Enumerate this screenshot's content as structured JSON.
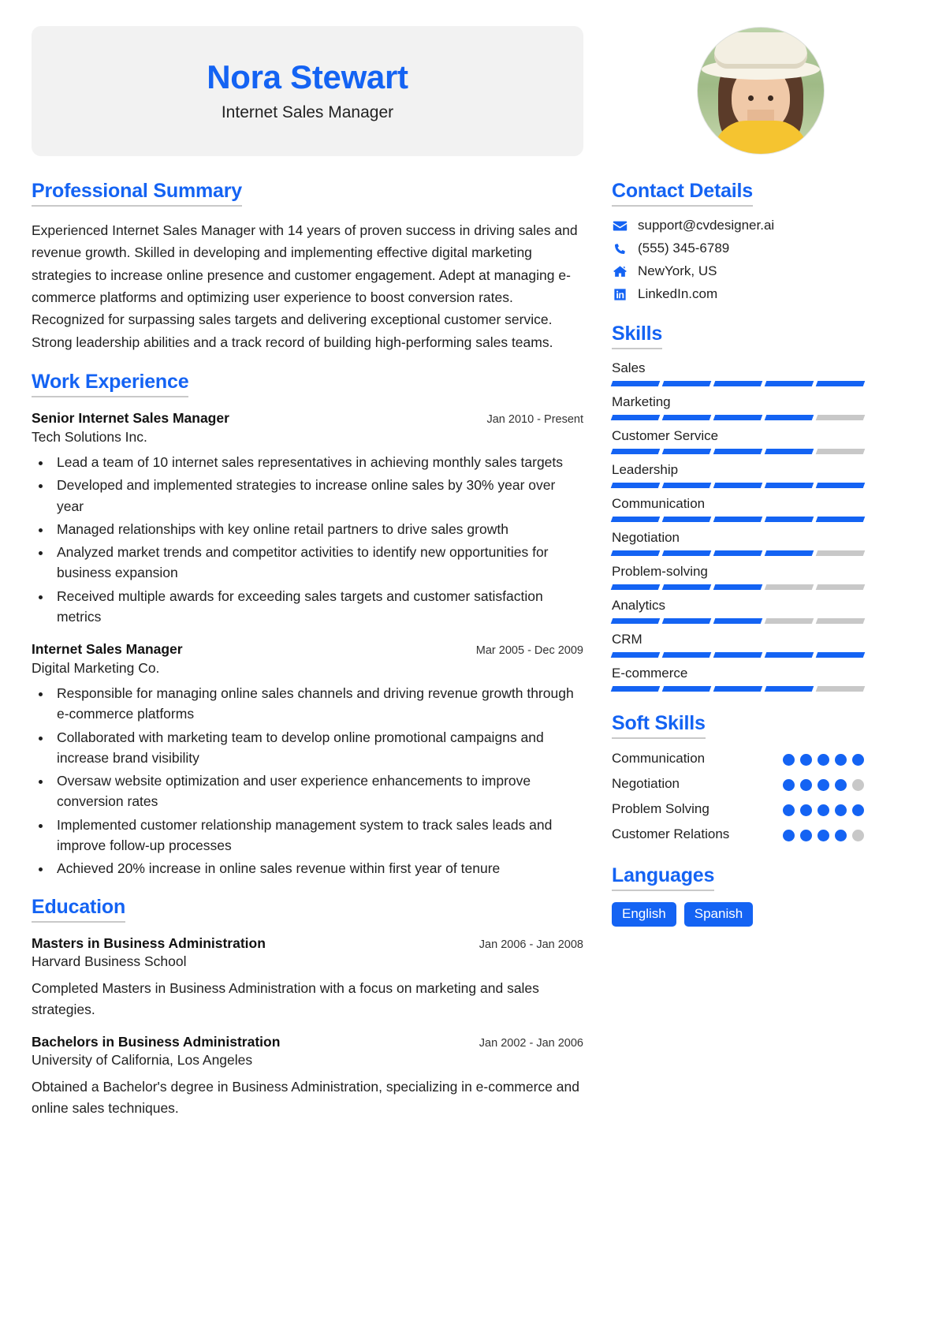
{
  "header": {
    "name": "Nora Stewart",
    "job_title": "Internet Sales Manager",
    "avatar_alt": "profile-photo",
    "accent_color": "#1463f3",
    "banner_color": "#f2f2f2"
  },
  "main": {
    "summary": {
      "title": "Professional Summary",
      "text": "Experienced Internet Sales Manager with 14 years of proven success in driving sales and revenue growth. Skilled in developing and implementing effective digital marketing strategies to increase online presence and customer engagement. Adept at managing e-commerce platforms and optimizing user experience to boost conversion rates. Recognized for surpassing sales targets and delivering exceptional customer service. Strong leadership abilities and a track record of building high-performing sales teams."
    },
    "work": {
      "title": "Work Experience",
      "jobs": [
        {
          "role": "Senior Internet Sales Manager",
          "date": "Jan 2010 - Present",
          "company": "Tech Solutions Inc.",
          "bullets": [
            "Lead a team of 10 internet sales representatives in achieving monthly sales targets",
            "Developed and implemented strategies to increase online sales by 30% year over year",
            "Managed relationships with key online retail partners to drive sales growth",
            "Analyzed market trends and competitor activities to identify new opportunities for business expansion",
            "Received multiple awards for exceeding sales targets and customer satisfaction metrics"
          ]
        },
        {
          "role": "Internet Sales Manager",
          "date": "Mar 2005 - Dec 2009",
          "company": "Digital Marketing Co.",
          "bullets": [
            "Responsible for managing online sales channels and driving revenue growth through e-commerce platforms",
            "Collaborated with marketing team to develop online promotional campaigns and increase brand visibility",
            "Oversaw website optimization and user experience enhancements to improve conversion rates",
            "Implemented customer relationship management system to track sales leads and improve follow-up processes",
            "Achieved 20% increase in online sales revenue within first year of tenure"
          ]
        }
      ]
    },
    "education": {
      "title": "Education",
      "entries": [
        {
          "degree": "Masters in Business Administration",
          "date": "Jan 2006 - Jan 2008",
          "school": "Harvard Business School",
          "description": "Completed Masters in Business Administration with a focus on marketing and sales strategies."
        },
        {
          "degree": "Bachelors in Business Administration",
          "date": "Jan 2002 - Jan 2006",
          "school": "University of California, Los Angeles",
          "description": "Obtained a Bachelor's degree in Business Administration, specializing in e-commerce and online sales techniques."
        }
      ]
    }
  },
  "sidebar": {
    "contact": {
      "title": "Contact Details",
      "items": [
        {
          "icon": "envelope-icon",
          "value": "support@cvdesigner.ai"
        },
        {
          "icon": "phone-icon",
          "value": "(555) 345-6789"
        },
        {
          "icon": "home-icon",
          "value": "NewYork, US"
        },
        {
          "icon": "linkedin-icon",
          "value": "LinkedIn.com"
        }
      ]
    },
    "skills": {
      "title": "Skills",
      "max_segments": 5,
      "items": [
        {
          "name": "Sales",
          "level": 5
        },
        {
          "name": "Marketing",
          "level": 4
        },
        {
          "name": "Customer Service",
          "level": 4
        },
        {
          "name": "Leadership",
          "level": 5
        },
        {
          "name": "Communication",
          "level": 5
        },
        {
          "name": "Negotiation",
          "level": 4
        },
        {
          "name": "Problem-solving",
          "level": 3
        },
        {
          "name": "Analytics",
          "level": 3
        },
        {
          "name": "CRM",
          "level": 5
        },
        {
          "name": "E-commerce",
          "level": 4
        }
      ]
    },
    "soft_skills": {
      "title": "Soft Skills",
      "max_dots": 5,
      "items": [
        {
          "name": "Communication",
          "level": 5
        },
        {
          "name": "Negotiation",
          "level": 4
        },
        {
          "name": "Problem Solving",
          "level": 5
        },
        {
          "name": "Customer Relations",
          "level": 4
        }
      ]
    },
    "languages": {
      "title": "Languages",
      "items": [
        "English",
        "Spanish"
      ]
    }
  }
}
